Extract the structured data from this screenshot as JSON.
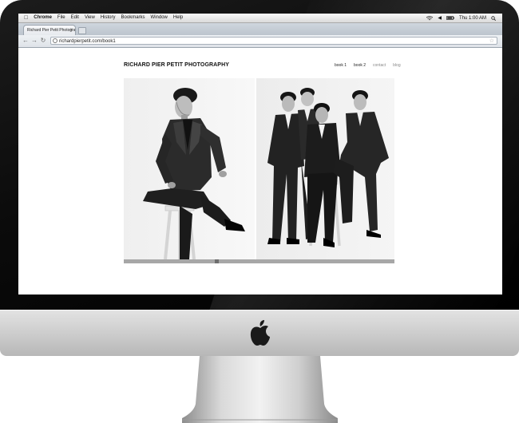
{
  "menubar": {
    "app_name": "Chrome",
    "items": [
      "File",
      "Edit",
      "View",
      "History",
      "Bookmarks",
      "Window",
      "Help"
    ],
    "clock": "Thu 1:00 AM"
  },
  "browser": {
    "tab_title": "Richard Pier Petit Photogra",
    "url": "richardpierpetit.com/book1"
  },
  "site": {
    "title": "RICHARD PIER PETIT PHOTOGRAPHY",
    "nav": [
      "book 1",
      "book 2",
      "contact",
      "blog"
    ]
  },
  "gallery": {
    "scroll_position": 0.34
  },
  "icons": {
    "apple_menu": "apple-icon",
    "wifi": "wifi-icon",
    "volume": "volume-icon",
    "battery": "battery-icon",
    "search": "search-icon",
    "back": "back-icon",
    "forward": "forward-icon",
    "reload": "reload-icon",
    "bookmark": "star-icon"
  }
}
